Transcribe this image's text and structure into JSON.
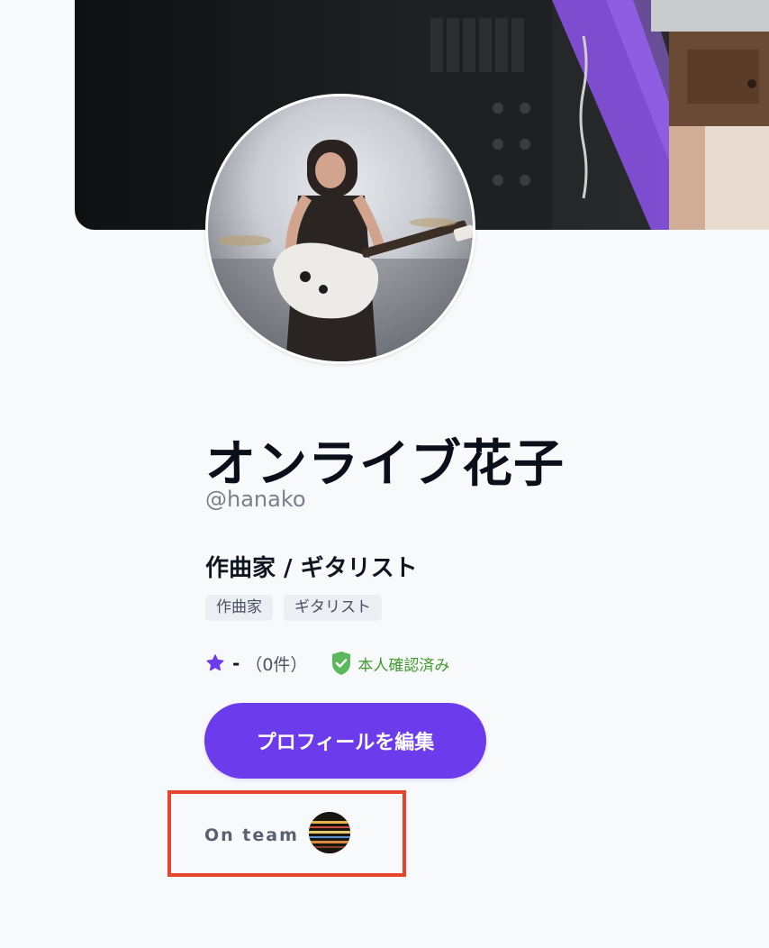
{
  "profile": {
    "name": "オンライブ花子",
    "handle": "@hanako",
    "title": "作曲家 / ギタリスト",
    "tags": [
      "作曲家",
      "ギタリスト"
    ],
    "rating_value": "-",
    "rating_count": "（0件）",
    "verified_label": "本人確認済み"
  },
  "actions": {
    "edit_profile_label": "プロフィールを編集"
  },
  "team": {
    "label": "On team"
  },
  "colors": {
    "accent": "#6c3beb",
    "verified": "#3f9a2a",
    "highlight": "#e5442d"
  }
}
